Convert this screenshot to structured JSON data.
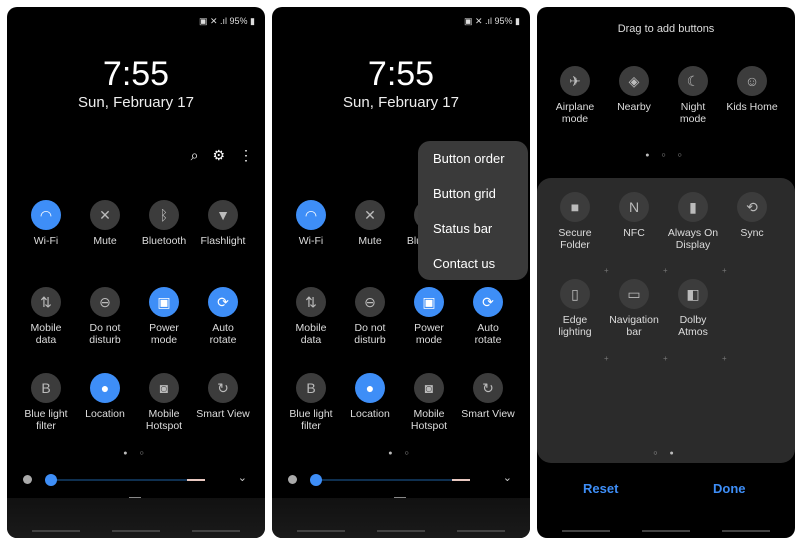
{
  "status_bar": {
    "icons": [
      "nfc-icon",
      "mute-icon",
      "signal-icon"
    ],
    "battery": "95%"
  },
  "lock": {
    "time": "7:55",
    "date": "Sun, February 17"
  },
  "toolbar": {
    "icons": [
      "search-icon",
      "gear-icon",
      "more-vert-icon"
    ]
  },
  "tiles": [
    {
      "label": "Wi-Fi",
      "icon": "wifi-icon",
      "glyph": "◠",
      "on": true
    },
    {
      "label": "Mute",
      "icon": "mute-icon",
      "glyph": "✕",
      "on": false
    },
    {
      "label": "Bluetooth",
      "icon": "bluetooth-icon",
      "glyph": "ᛒ",
      "on": false
    },
    {
      "label": "Flashlight",
      "icon": "flashlight-icon",
      "glyph": "▼",
      "on": false
    },
    {
      "label": "Mobile\ndata",
      "icon": "mobile-data-icon",
      "glyph": "⇅",
      "on": false
    },
    {
      "label": "Do not\ndisturb",
      "icon": "do-not-disturb-icon",
      "glyph": "⊖",
      "on": false
    },
    {
      "label": "Power\nmode",
      "icon": "power-mode-icon",
      "glyph": "▣",
      "on": true
    },
    {
      "label": "Auto\nrotate",
      "icon": "auto-rotate-icon",
      "glyph": "⟳",
      "on": true
    },
    {
      "label": "Blue light\nfilter",
      "icon": "blue-light-icon",
      "glyph": "B",
      "on": false
    },
    {
      "label": "Location",
      "icon": "location-icon",
      "glyph": "●",
      "on": true
    },
    {
      "label": "Mobile\nHotspot",
      "icon": "hotspot-icon",
      "glyph": "◙",
      "on": false
    },
    {
      "label": "Smart View",
      "icon": "smart-view-icon",
      "glyph": "↻",
      "on": false
    }
  ],
  "menu": {
    "items": [
      "Button order",
      "Button grid",
      "Status bar",
      "Contact us"
    ]
  },
  "edit": {
    "title": "Drag to add buttons",
    "available": [
      {
        "label": "Airplane\nmode",
        "icon": "airplane-icon",
        "glyph": "✈"
      },
      {
        "label": "Nearby",
        "icon": "nearby-icon",
        "glyph": "◈"
      },
      {
        "label": "Night\nmode",
        "icon": "night-mode-icon",
        "glyph": "☾"
      },
      {
        "label": "Kids Home",
        "icon": "kids-home-icon",
        "glyph": "☺"
      }
    ],
    "grid": [
      {
        "label": "Secure\nFolder",
        "icon": "secure-folder-icon",
        "glyph": "■"
      },
      {
        "label": "NFC",
        "icon": "nfc-icon",
        "glyph": "N"
      },
      {
        "label": "Always On\nDisplay",
        "icon": "always-on-display-icon",
        "glyph": "▮"
      },
      {
        "label": "Sync",
        "icon": "sync-icon",
        "glyph": "⟲"
      },
      {
        "label": "Edge\nlighting",
        "icon": "edge-lighting-icon",
        "glyph": "▯"
      },
      {
        "label": "Navigation\nbar",
        "icon": "navigation-bar-icon",
        "glyph": "▭"
      },
      {
        "label": "Dolby\nAtmos",
        "icon": "dolby-icon",
        "glyph": "◧"
      }
    ],
    "reset": "Reset",
    "done": "Done"
  },
  "brightness": 0.02,
  "colors": {
    "accent": "#3e8ef7",
    "tile_off": "#3c3c3c"
  }
}
